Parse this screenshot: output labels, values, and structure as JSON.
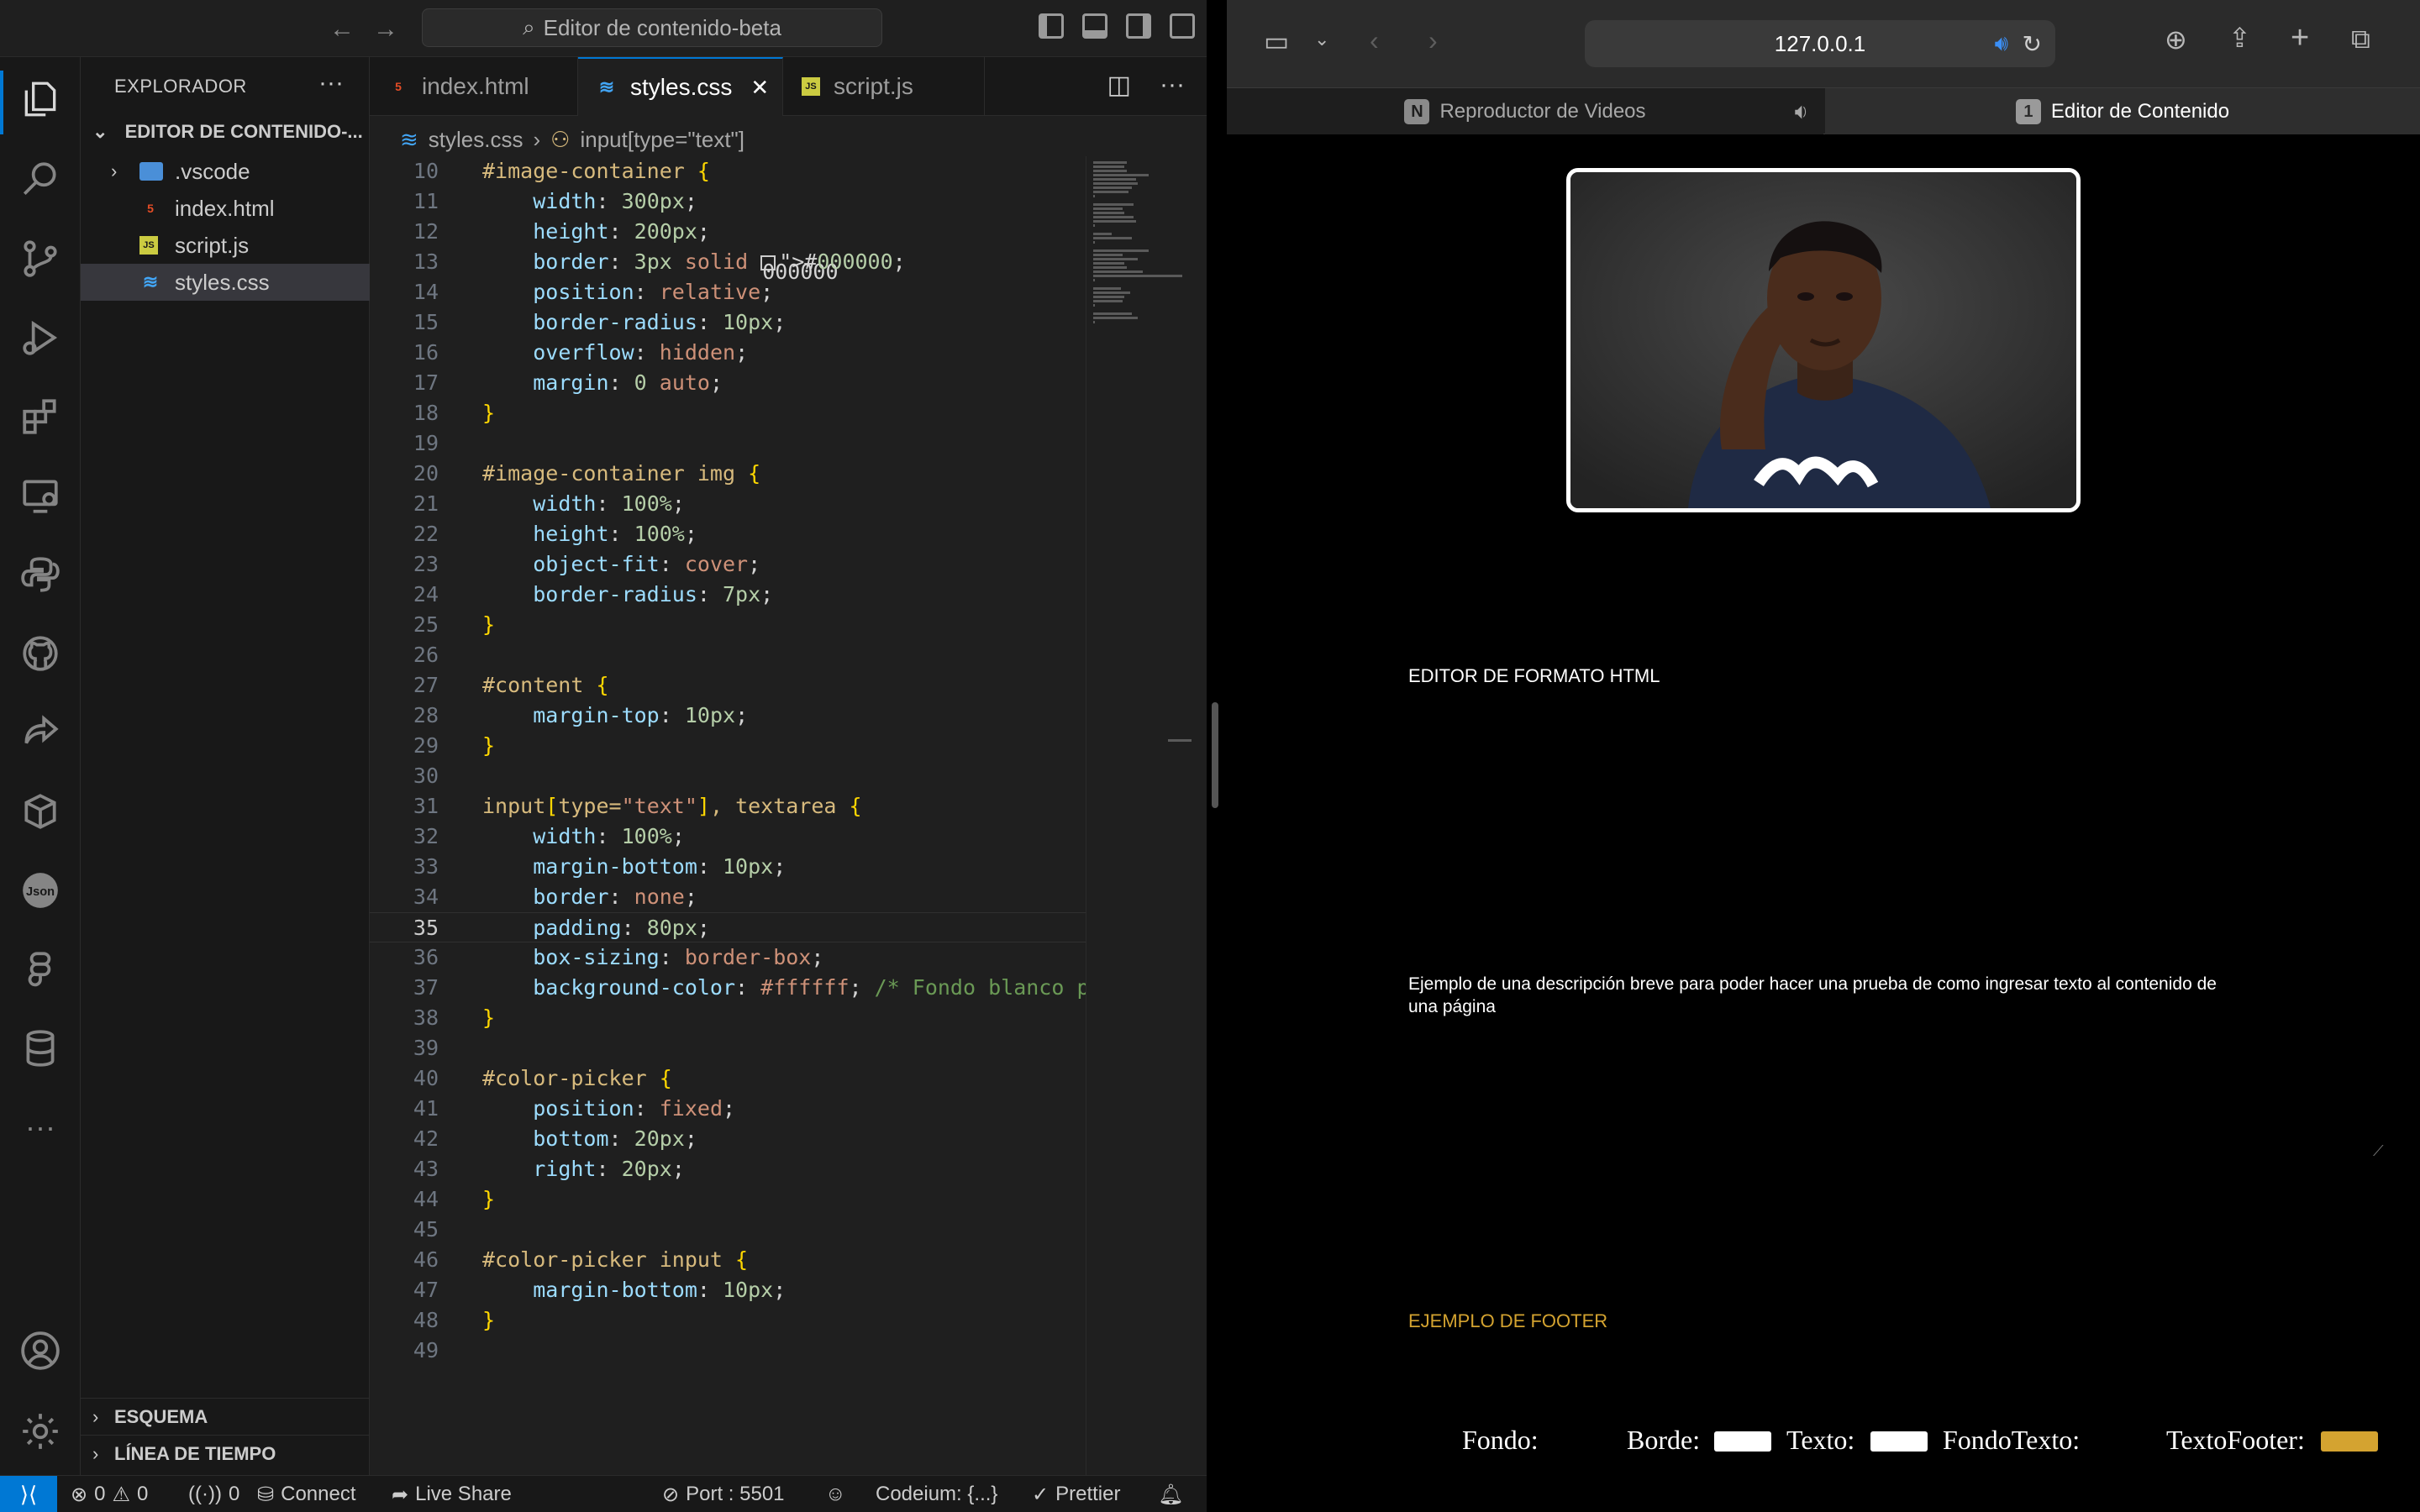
{
  "vscode": {
    "command_center": "Editor de contenido-beta",
    "explorer": {
      "title": "EXPLORADOR",
      "folder": "EDITOR DE CONTENIDO-...",
      "files": [
        {
          "name": ".vscode",
          "type": "folder"
        },
        {
          "name": "index.html",
          "type": "html"
        },
        {
          "name": "script.js",
          "type": "js"
        },
        {
          "name": "styles.css",
          "type": "css",
          "selected": true
        }
      ],
      "outline": "ESQUEMA",
      "timeline": "LÍNEA DE TIEMPO"
    },
    "tabs": [
      {
        "label": "index.html",
        "type": "html"
      },
      {
        "label": "styles.css",
        "type": "css",
        "active": true
      },
      {
        "label": "script.js",
        "type": "js"
      }
    ],
    "breadcrumb": {
      "file": "styles.css",
      "symbol": "input[type=\"text\"]"
    },
    "current_line": 35,
    "code_lines": [
      {
        "n": 10,
        "text": "#image-container {"
      },
      {
        "n": 11,
        "text": "    width: 300px;"
      },
      {
        "n": 12,
        "text": "    height: 200px;"
      },
      {
        "n": 13,
        "text": "    border: 3px solid #000000;"
      },
      {
        "n": 14,
        "text": "    position: relative;"
      },
      {
        "n": 15,
        "text": "    border-radius: 10px;"
      },
      {
        "n": 16,
        "text": "    overflow: hidden;"
      },
      {
        "n": 17,
        "text": "    margin: 0 auto;"
      },
      {
        "n": 18,
        "text": "}"
      },
      {
        "n": 19,
        "text": ""
      },
      {
        "n": 20,
        "text": "#image-container img {"
      },
      {
        "n": 21,
        "text": "    width: 100%;"
      },
      {
        "n": 22,
        "text": "    height: 100%;"
      },
      {
        "n": 23,
        "text": "    object-fit: cover;"
      },
      {
        "n": 24,
        "text": "    border-radius: 7px;"
      },
      {
        "n": 25,
        "text": "}"
      },
      {
        "n": 26,
        "text": ""
      },
      {
        "n": 27,
        "text": "#content {"
      },
      {
        "n": 28,
        "text": "    margin-top: 10px;"
      },
      {
        "n": 29,
        "text": "}"
      },
      {
        "n": 30,
        "text": ""
      },
      {
        "n": 31,
        "text": "input[type=\"text\"], textarea {"
      },
      {
        "n": 32,
        "text": "    width: 100%;"
      },
      {
        "n": 33,
        "text": "    margin-bottom: 10px;"
      },
      {
        "n": 34,
        "text": "    border: none;"
      },
      {
        "n": 35,
        "text": "    padding: 80px;"
      },
      {
        "n": 36,
        "text": "    box-sizing: border-box;"
      },
      {
        "n": 37,
        "text": "    background-color: #ffffff; /* Fondo blanco p"
      },
      {
        "n": 38,
        "text": "}"
      },
      {
        "n": 39,
        "text": ""
      },
      {
        "n": 40,
        "text": "#color-picker {"
      },
      {
        "n": 41,
        "text": "    position: fixed;"
      },
      {
        "n": 42,
        "text": "    bottom: 20px;"
      },
      {
        "n": 43,
        "text": "    right: 20px;"
      },
      {
        "n": 44,
        "text": "}"
      },
      {
        "n": 45,
        "text": ""
      },
      {
        "n": 46,
        "text": "#color-picker input {"
      },
      {
        "n": 47,
        "text": "    margin-bottom: 10px;"
      },
      {
        "n": 48,
        "text": "}"
      },
      {
        "n": 49,
        "text": ""
      }
    ],
    "statusbar": {
      "errors": "0",
      "warnings": "0",
      "ports": "0",
      "connect": "Connect",
      "live_share": "Live Share",
      "port": "Port : 5501",
      "codeium": "Codeium: {...}",
      "prettier": "Prettier"
    }
  },
  "safari": {
    "address": "127.0.0.1",
    "tabs": [
      {
        "label": "Reproductor de Videos",
        "badge": "N",
        "muted": true
      },
      {
        "label": "Editor de Contenido",
        "badge": "1",
        "active": true
      }
    ],
    "page": {
      "title": "EDITOR DE FORMATO HTML",
      "description": "Ejemplo de una descripción breve para poder hacer una prueba de como ingresar texto al contenido de una página",
      "footer": "EJEMPLO DE FOOTER",
      "pickers": [
        {
          "label": "Fondo:",
          "color": "#000000"
        },
        {
          "label": "Borde:",
          "color": "#ffffff"
        },
        {
          "label": "Texto:",
          "color": "#ffffff"
        },
        {
          "label": "FondoTexto:",
          "color": "#000000"
        },
        {
          "label": "TextoFooter:",
          "color": "#d4a330"
        }
      ]
    }
  },
  "colors": {
    "accent": "#0078d4",
    "footer_text": "#d4a330"
  }
}
